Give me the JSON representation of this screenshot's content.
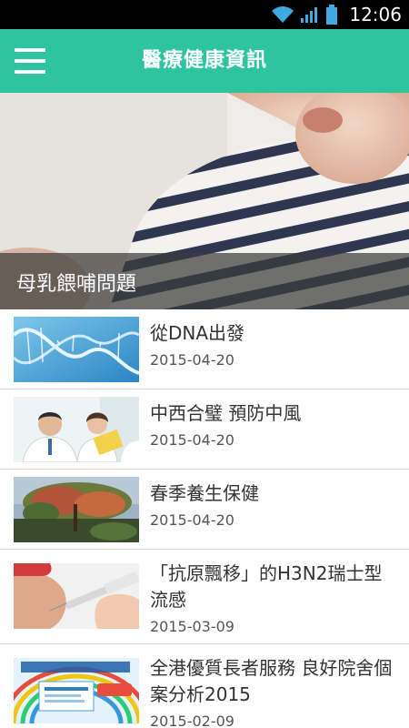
{
  "status_bar": {
    "time": "12:06"
  },
  "app_bar": {
    "title": "醫療健康資訊",
    "menu_icon": "hamburger-menu-icon"
  },
  "hero": {
    "caption": "母乳餵哺問題"
  },
  "news": [
    {
      "title": "從DNA出發",
      "date": "2015-04-20",
      "thumb": "dna-helix-image"
    },
    {
      "title": "中西合璧 預防中風",
      "date": "2015-04-20",
      "thumb": "doctors-image"
    },
    {
      "title": "春季養生保健",
      "date": "2015-04-20",
      "thumb": "tree-landscape-image"
    },
    {
      "title": "「抗原飄移」的H3N2瑞士型流感",
      "date": "2015-03-09",
      "thumb": "vaccination-image"
    },
    {
      "title": "全港優質長者服務 良好院舍個案分析2015",
      "date": "2015-02-09",
      "thumb": "elderly-service-poster-image"
    }
  ],
  "colors": {
    "accent": "#2ec4a0",
    "status_bar": "#000000"
  }
}
